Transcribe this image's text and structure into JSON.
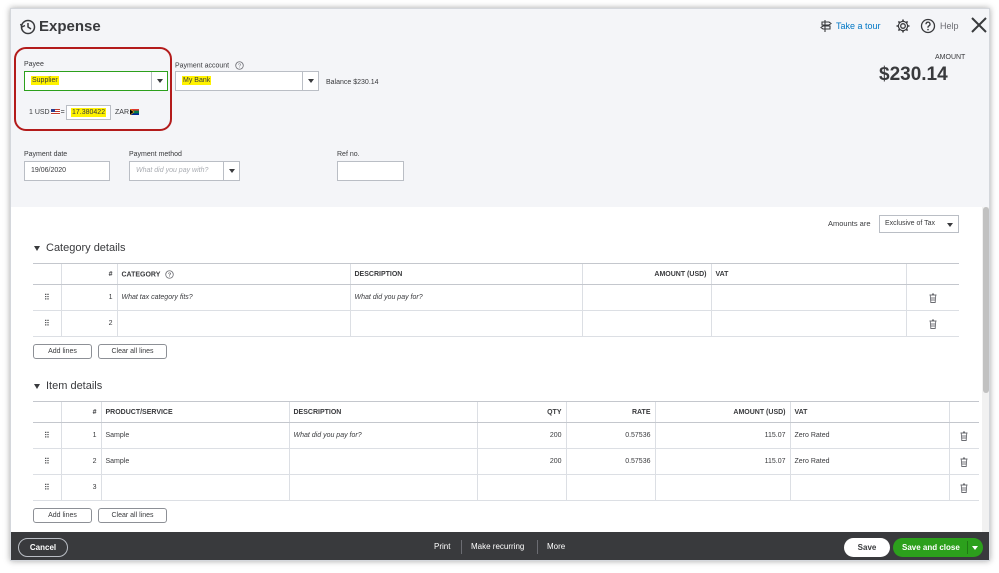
{
  "header": {
    "title": "Expense",
    "take_tour": "Take a tour",
    "help": "Help",
    "amount_label": "AMOUNT",
    "amount": "$230.14"
  },
  "form": {
    "payee_label": "Payee",
    "payee_value": "Supplier",
    "payment_account_label": "Payment account",
    "payment_account_value": "My Bank",
    "balance": "Balance $230.14",
    "rate_left": "1 USD",
    "rate_equals": "=",
    "rate_value": "17.380422",
    "rate_right": "ZAR",
    "payment_date_label": "Payment date",
    "payment_date_value": "19/06/2020",
    "payment_method_label": "Payment method",
    "payment_method_placeholder": "What did you pay with?",
    "ref_label": "Ref no.",
    "ref_value": ""
  },
  "amounts_are": {
    "label": "Amounts are",
    "value": "Exclusive of Tax"
  },
  "category_details": {
    "title": "Category details",
    "columns": [
      "#",
      "CATEGORY",
      "DESCRIPTION",
      "AMOUNT (USD)",
      "VAT"
    ],
    "rows": [
      {
        "num": "1",
        "category_placeholder": "What tax category fits?",
        "description_placeholder": "What did you pay for?"
      },
      {
        "num": "2",
        "category_placeholder": "",
        "description_placeholder": ""
      }
    ],
    "add_lines": "Add lines",
    "clear_all": "Clear all lines"
  },
  "item_details": {
    "title": "Item details",
    "columns": [
      "#",
      "PRODUCT/SERVICE",
      "DESCRIPTION",
      "QTY",
      "RATE",
      "AMOUNT (USD)",
      "VAT"
    ],
    "rows": [
      {
        "num": "1",
        "product": "Sample",
        "description_placeholder": "What did you pay for?",
        "qty": "200",
        "rate": "0.57536",
        "amount": "115.07",
        "vat": "Zero Rated"
      },
      {
        "num": "2",
        "product": "Sample",
        "description_placeholder": "",
        "qty": "200",
        "rate": "0.57536",
        "amount": "115.07",
        "vat": "Zero Rated"
      },
      {
        "num": "3",
        "product": "",
        "description_placeholder": "",
        "qty": "",
        "rate": "",
        "amount": "",
        "vat": ""
      }
    ],
    "add_lines": "Add lines",
    "clear_all": "Clear all lines"
  },
  "footer": {
    "cancel": "Cancel",
    "print": "Print",
    "make_recurring": "Make recurring",
    "more": "More",
    "save": "Save",
    "save_and_close": "Save and close"
  },
  "colors": {
    "brand_green": "#2ca01c",
    "link_blue": "#0077c5",
    "highlight": "#fff200",
    "annotation_red": "#b31b1b",
    "footer_bg": "#393a3d"
  }
}
